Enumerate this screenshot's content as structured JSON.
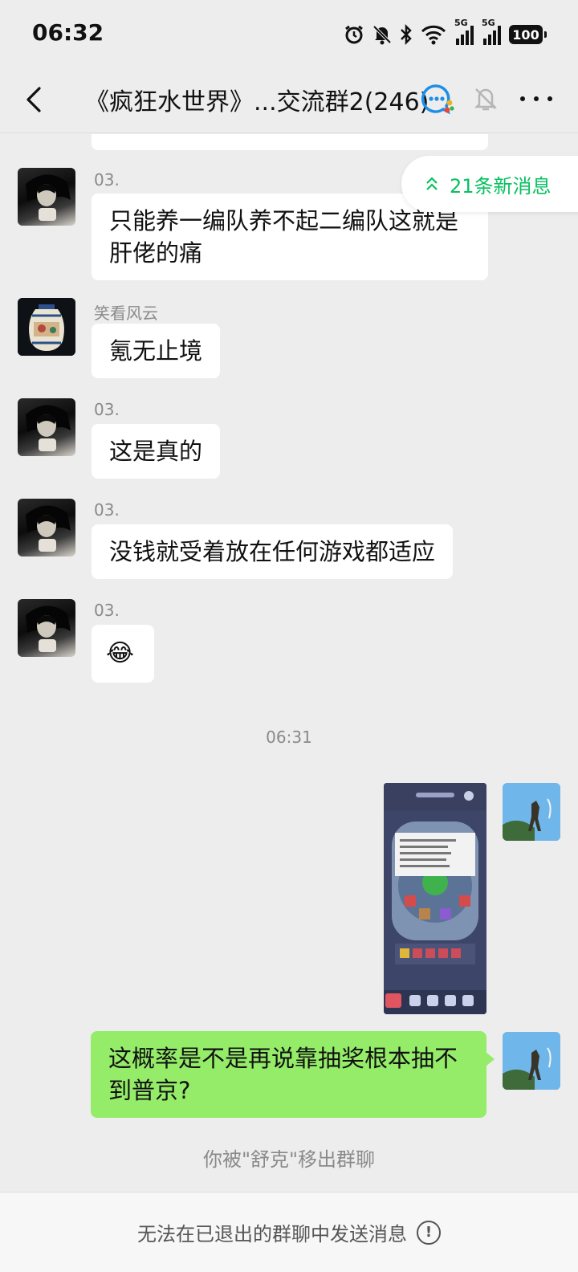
{
  "status_bar": {
    "time": "06:32",
    "network_1": "5G",
    "network_2": "5G",
    "battery": "100"
  },
  "header": {
    "title": "《疯狂水世界》...交流群2(246)"
  },
  "new_messages_badge": "21条新消息",
  "messages": [
    {
      "sender": "03.",
      "text_line1": "只能养一编队养不起二编队这就是",
      "text_line2": "肝佬的痛"
    },
    {
      "sender": "笑看风云",
      "text": "氪无止境"
    },
    {
      "sender": "03.",
      "text": "这是真的"
    },
    {
      "sender": "03.",
      "text": "没钱就受着放在任何游戏都适应"
    },
    {
      "sender": "03.",
      "emoji": "😂"
    }
  ],
  "time_divider": "06:31",
  "outgoing": {
    "text_line1": "这概率是不是再说靠抽奖根本抽不",
    "text_line2": "到普京?"
  },
  "system_note": "你被\"舒克\"移出群聊",
  "footer": {
    "text": "无法在已退出的群聊中发送消息",
    "info_symbol": "!"
  },
  "colors": {
    "background": "#ededed",
    "bubble_in": "#ffffff",
    "bubble_out": "#95ec69",
    "accent": "#07c160"
  },
  "icons": [
    "alarm-icon",
    "bell-off-icon",
    "bluetooth-icon",
    "wifi-icon",
    "signal-icon",
    "battery-icon",
    "back-chevron-icon",
    "group-chat-icon",
    "mute-bell-icon",
    "more-dots-icon",
    "double-chevron-up-icon",
    "info-circle-icon"
  ]
}
